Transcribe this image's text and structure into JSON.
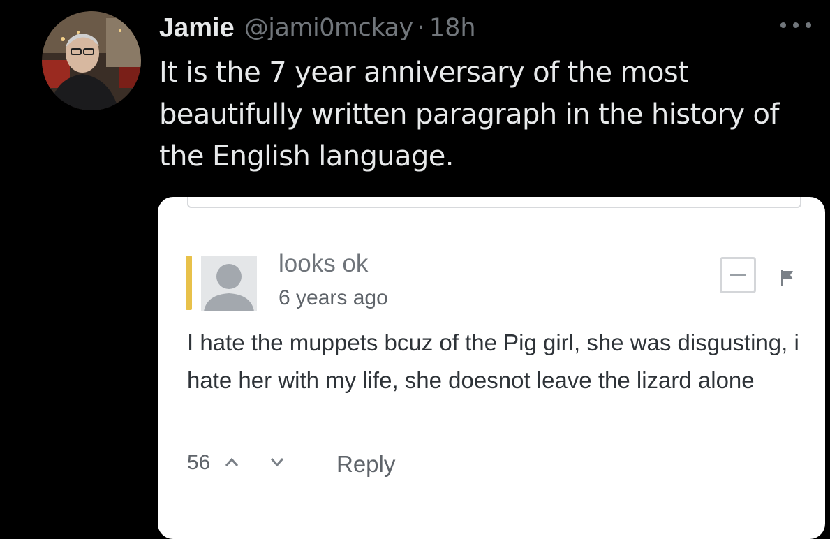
{
  "tweet": {
    "author": {
      "display_name": "Jamie",
      "handle": "@jami0mckay",
      "separator": "·",
      "time": "18h",
      "avatar_icon": "user-photo-avatar"
    },
    "more_icon": "more-horizontal-icon",
    "text": "It is the 7 year anniversary of the most beautifully written paragraph in the history of the English language."
  },
  "embedded_comment": {
    "commenter_name": "looks ok",
    "timestamp": "6 years ago",
    "body": "I hate the muppets bcuz of the Pig girl, she was disgusting, i hate her with my life, she doesnot leave the lizard alone",
    "votes": "56",
    "reply_label": "Reply",
    "accent_color": "#e8c14a",
    "icons": {
      "collapse": "minus-box-icon",
      "flag": "flag-icon",
      "upvote": "chevron-up-icon",
      "downvote": "chevron-down-icon"
    }
  },
  "colors": {
    "background": "#000000",
    "primary_text": "#e7e9ea",
    "secondary_text": "#71767b"
  }
}
